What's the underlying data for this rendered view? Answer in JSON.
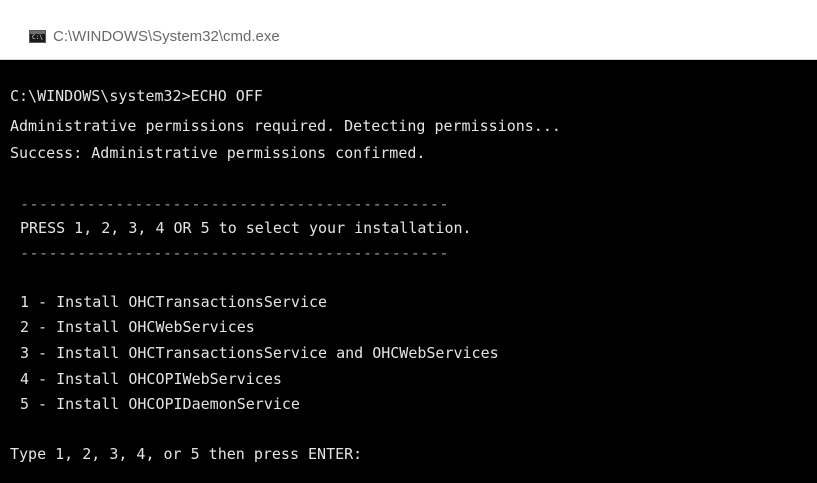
{
  "window": {
    "title": "C:\\WINDOWS\\System32\\cmd.exe",
    "icon": "cmd-icon"
  },
  "console": {
    "lines": [
      "C:\\WINDOWS\\system32>ECHO OFF",
      "Administrative permissions required. Detecting permissions...",
      "Success: Administrative permissions confirmed."
    ],
    "separator": "---------------------------------------------",
    "prompt_heading": "PRESS 1, 2, 3, 4 OR 5 to select your installation.",
    "options": [
      "1 - Install OHCTransactionsService",
      "2 - Install OHCWebServices",
      "3 - Install OHCTransactionsService and OHCWebServices",
      "4 - Install OHCOPIWebServices",
      "5 - Install OHCOPIDaemonService"
    ],
    "input_prompt": "Type 1, 2, 3, 4, or 5 then press ENTER:"
  }
}
